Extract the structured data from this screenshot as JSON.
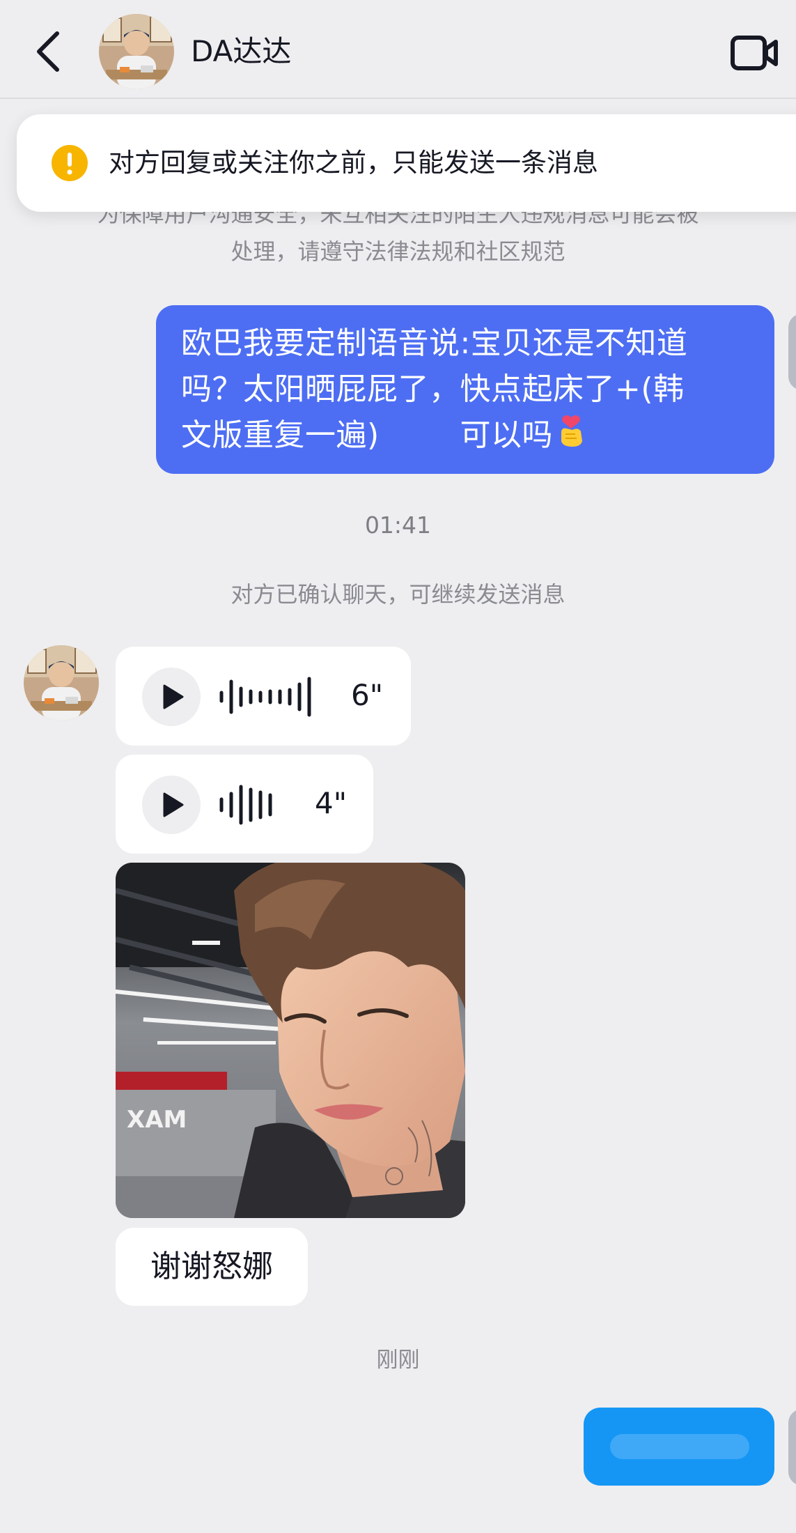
{
  "header": {
    "contact_name": "DA达达",
    "back_icon": "chevron-left-icon",
    "video_icon": "video-camera-icon"
  },
  "notice": {
    "icon": "warning-icon",
    "icon_color": "#f7b500",
    "text": "对方回复或关注你之前，只能发送一条消息"
  },
  "system": {
    "safety_line1": "为保障用户沟通安全，未互相关注的陌生人违规消息可能会被",
    "safety_line2": "处理，请遵守法律法规和社区规范",
    "time_1": "01:41",
    "confirmed": "对方已确认聊天，可继续发送消息",
    "time_2": "刚刚"
  },
  "messages": {
    "outgoing_1": {
      "line1": "欧巴我要定制语音说:宝贝还是不知道",
      "line2": "吗？太阳晒屁屁了，快点起床了+(韩",
      "line3": "文版重复一遍)        可以吗",
      "emoji": "finger-heart-emoji"
    },
    "voice_1": {
      "duration": "6\""
    },
    "voice_2": {
      "duration": "4\""
    },
    "photo": {
      "overlay_text": "XAM"
    },
    "incoming_text": "谢谢怒娜"
  },
  "colors": {
    "background": "#eeeef0",
    "outgoing_bubble": "#4d6ef3",
    "outgoing_bubble_2": "#1596f5",
    "incoming_bubble": "#ffffff"
  }
}
